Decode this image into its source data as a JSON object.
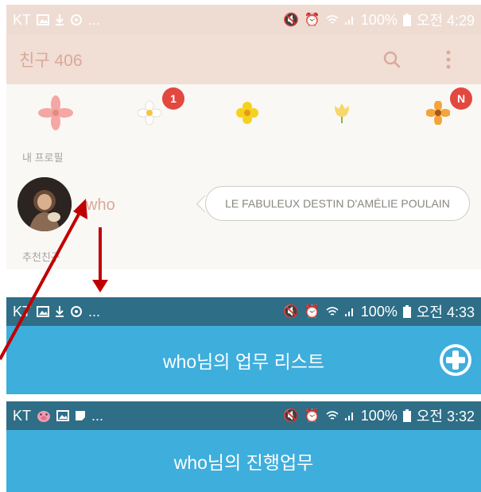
{
  "panel1": {
    "status_bar": {
      "carrier": "KT",
      "extra": "...",
      "battery": "100%",
      "time": "오전 4:29"
    },
    "app_bar": {
      "title": "친구 406"
    },
    "flowers": [
      {
        "name": "pink-lily-flower",
        "badge": ""
      },
      {
        "name": "white-flower",
        "badge": "1"
      },
      {
        "name": "yellow-flower",
        "badge": ""
      },
      {
        "name": "tulip-flower",
        "badge": ""
      },
      {
        "name": "orange-flower",
        "badge": "N"
      }
    ],
    "my_profile_label": "내 프로필",
    "my_profile": {
      "name": "who",
      "status_message": "LE FABULEUX DESTIN D'AMÉLIE POULAIN"
    },
    "recommended_label": "추천친구"
  },
  "panel2": {
    "status_bar": {
      "carrier": "KT",
      "extra": "...",
      "battery": "100%",
      "time": "오전 4:33"
    },
    "title": "who님의 업무 리스트"
  },
  "panel3": {
    "status_bar": {
      "carrier": "KT",
      "extra": "...",
      "battery": "100%",
      "time": "오전 3:32"
    },
    "title": "who님의 진행업무"
  },
  "colors": {
    "accent_red": "#c00000",
    "kakao_bar": "#f1ded5",
    "task_blue": "#3eaedc",
    "status_dark": "#2e6e87",
    "badge_red": "#e2483f"
  }
}
